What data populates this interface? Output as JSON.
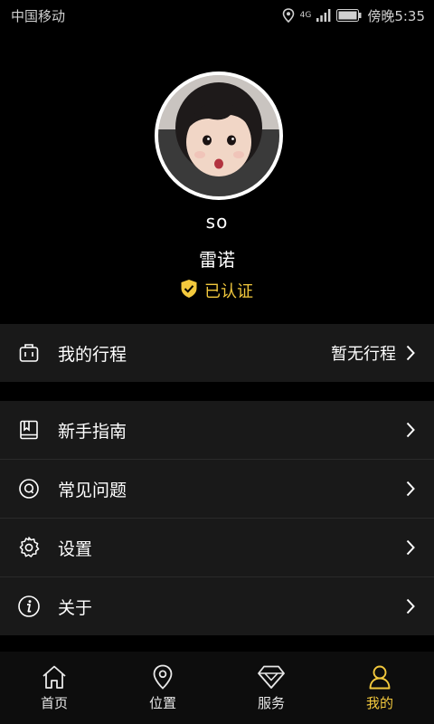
{
  "status_bar": {
    "carrier": "中国移动",
    "network": "4G",
    "time": "傍晚5:35"
  },
  "profile": {
    "username": "so",
    "real_name": "雷诺",
    "verified_label": "已认证"
  },
  "trips": {
    "label": "我的行程",
    "value": "暂无行程"
  },
  "menu": {
    "items": [
      {
        "label": "新手指南",
        "icon": "book-icon"
      },
      {
        "label": "常见问题",
        "icon": "question-icon"
      },
      {
        "label": "设置",
        "icon": "gear-icon"
      },
      {
        "label": "关于",
        "icon": "info-icon"
      }
    ]
  },
  "bottom_nav": {
    "items": [
      {
        "label": "首页",
        "icon": "home-icon",
        "active": false
      },
      {
        "label": "位置",
        "icon": "location-pin-icon",
        "active": false
      },
      {
        "label": "服务",
        "icon": "diamond-icon",
        "active": false
      },
      {
        "label": "我的",
        "icon": "person-icon",
        "active": true
      }
    ]
  },
  "colors": {
    "background": "#000000",
    "row_background": "#191919",
    "accent": "#f3c93d"
  }
}
